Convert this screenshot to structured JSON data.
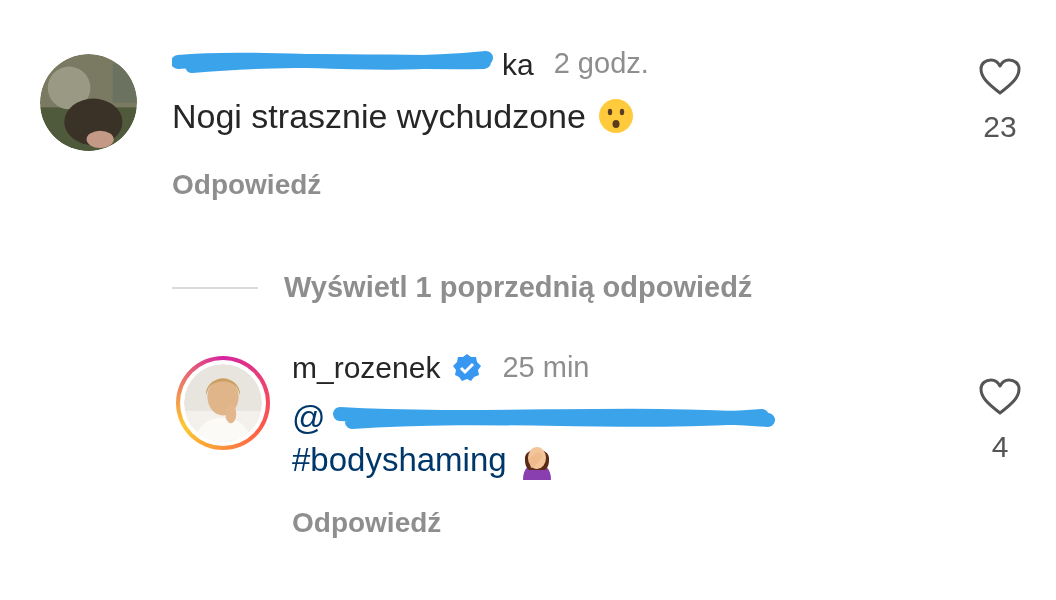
{
  "comments": [
    {
      "username": "ka",
      "time": "2 godz.",
      "text": "Nogi strasznie wychudzone",
      "verified": false,
      "reply_label": "Odpowiedź",
      "like_count": "23",
      "liked": false,
      "avatar_ring": false
    },
    {
      "kind": "toggle",
      "label": "Wyświetl 1 poprzednią odpowiedź"
    },
    {
      "username": "m_rozenek",
      "time": "25 min",
      "mention": "@",
      "text": "#bodyshaming",
      "verified": true,
      "reply_label": "Odpowiedź",
      "like_count": "4",
      "liked": false,
      "avatar_ring": true
    }
  ]
}
